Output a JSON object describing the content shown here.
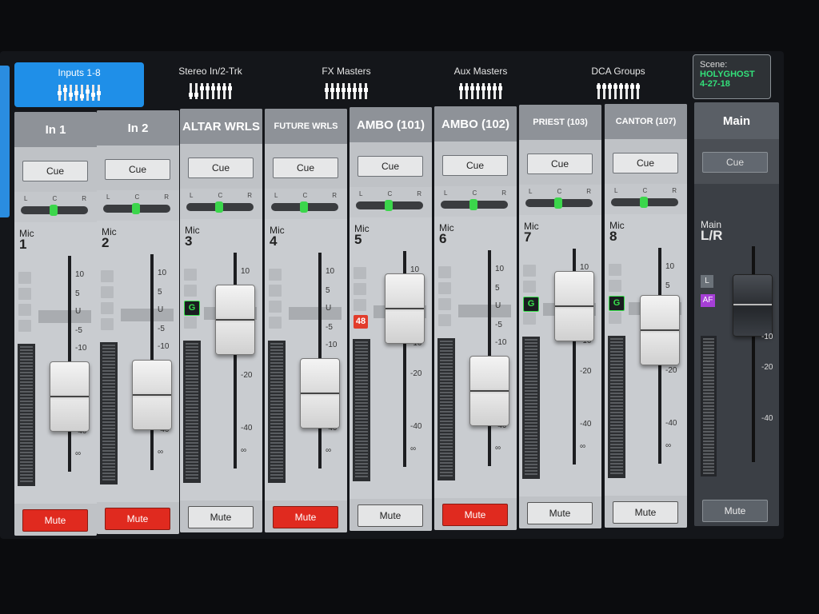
{
  "tabs": [
    {
      "label": "Inputs 1-8",
      "active": true
    },
    {
      "label": "Stereo In/2-Trk",
      "active": false
    },
    {
      "label": "FX Masters",
      "active": false
    },
    {
      "label": "Aux Masters",
      "active": false
    },
    {
      "label": "DCA Groups",
      "active": false
    }
  ],
  "scene": {
    "label": "Scene:",
    "name": "HOLYGHOST",
    "date": "4-27-18"
  },
  "pan_labels": {
    "l": "L",
    "c": "C",
    "r": "R"
  },
  "scale": [
    "10",
    "5",
    "U",
    "-5",
    "-10",
    "-20",
    "-40",
    "∞"
  ],
  "channels": [
    {
      "name": "In 1",
      "cue": "Cue",
      "source": "Mic",
      "number": "1",
      "mute": "Mute",
      "muted": true,
      "badge": "",
      "fader_level": 0.28
    },
    {
      "name": "In 2",
      "cue": "Cue",
      "source": "Mic",
      "number": "2",
      "mute": "Mute",
      "muted": true,
      "badge": "",
      "fader_level": 0.28
    },
    {
      "name": "ALTAR WRLS",
      "cue": "Cue",
      "source": "Mic",
      "number": "3",
      "mute": "Mute",
      "muted": false,
      "badge": "G",
      "fader_level": 0.78
    },
    {
      "name": "FUTURE WRLS",
      "cue": "Cue",
      "source": "Mic",
      "number": "4",
      "mute": "Mute",
      "muted": true,
      "badge": "",
      "fader_level": 0.28
    },
    {
      "name": "AMBO (101)",
      "cue": "Cue",
      "source": "Mic",
      "number": "5",
      "mute": "Mute",
      "muted": false,
      "badge": "48",
      "fader_level": 0.85
    },
    {
      "name": "AMBO (102)",
      "cue": "Cue",
      "source": "Mic",
      "number": "6",
      "mute": "Mute",
      "muted": true,
      "badge": "",
      "fader_level": 0.28
    },
    {
      "name": "PRIEST (103)",
      "cue": "Cue",
      "source": "Mic",
      "number": "7",
      "mute": "Mute",
      "muted": false,
      "badge": "G",
      "fader_level": 0.85
    },
    {
      "name": "CANTOR (107)",
      "cue": "Cue",
      "source": "Mic",
      "number": "8",
      "mute": "Mute",
      "muted": false,
      "badge": "G",
      "fader_level": 0.68
    }
  ],
  "main": {
    "name": "Main",
    "cue": "Cue",
    "label1": "Main",
    "label2": "L/R",
    "badge_l": "L",
    "badge_af": "AF",
    "mute": "Mute",
    "fader_level": 0.82
  },
  "colors": {
    "tab_active": "#1f8fe8",
    "mute_on": "#e02a1f",
    "scene_text": "#33e07a",
    "gate_badge": "#38e04c",
    "phantom_badge": "#e23c2b"
  }
}
